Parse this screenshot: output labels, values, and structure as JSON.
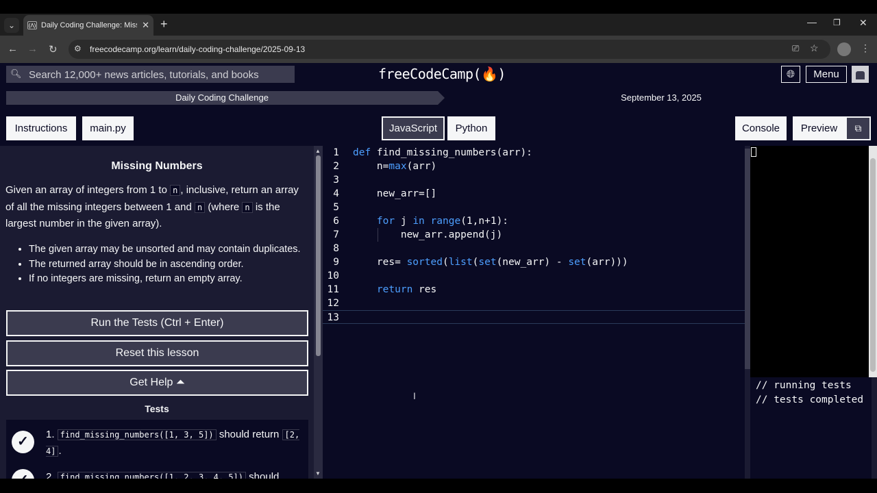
{
  "browser": {
    "tab_title": "Daily Coding Challenge: Missing Numbers",
    "tab_favicon": "fcc-icon",
    "url": "freecodecamp.org/learn/daily-coding-challenge/2025-09-13",
    "icons": [
      "tab-list-icon",
      "close-icon",
      "plus-icon",
      "minimize-icon",
      "restore-icon",
      "close-window-icon",
      "back-icon",
      "forward-icon",
      "reload-icon",
      "site-info-icon",
      "install-icon",
      "star-icon",
      "kebab-menu-icon"
    ]
  },
  "nav": {
    "search_placeholder": "Search 12,000+ news articles, tutorials, and books",
    "logo": "freeCodeCamp(🔥)",
    "menu_label": "Menu"
  },
  "breadcrumb": {
    "section": "Daily Coding Challenge",
    "date": "September 13, 2025"
  },
  "toolbar": {
    "instructions": "Instructions",
    "file": "main.py",
    "lang_js": "JavaScript",
    "lang_py": "Python",
    "selected_language": "JavaScript",
    "console": "Console",
    "preview": "Preview"
  },
  "challenge": {
    "title": "Missing Numbers",
    "desc_1": "Given an array of integers from 1 to ",
    "n": "n",
    "desc_2": ", inclusive, return an array of all the missing integers between 1 and ",
    "desc_3": " (where ",
    "desc_4": " is the largest number in the given array).",
    "rules": [
      "The given array may be unsorted and may contain duplicates.",
      "The returned array should be in ascending order.",
      "If no integers are missing, return an empty array."
    ]
  },
  "actions": {
    "run": "Run the Tests (Ctrl + Enter)",
    "reset": "Reset this lesson",
    "help": "Get Help ⏶"
  },
  "tests": {
    "heading": "Tests",
    "items": [
      {
        "num": "1.",
        "code": "find_missing_numbers([1, 3, 5])",
        "text": " should return ",
        "result": "[2, 4]",
        "end": ".",
        "passed": true
      },
      {
        "num": "2.",
        "code": "find_missing_numbers([1, 2, 3, 4, 5])",
        "text": " should",
        "passed": true
      }
    ]
  },
  "editor": {
    "lines": [
      {
        "n": "1",
        "tokens": [
          [
            "kw",
            "def"
          ],
          [
            "",
            " find_missing_numbers(arr):"
          ]
        ]
      },
      {
        "n": "2",
        "tokens": [
          [
            "",
            "    n="
          ],
          [
            "fn",
            "max"
          ],
          [
            "",
            "(arr)"
          ]
        ]
      },
      {
        "n": "3",
        "tokens": []
      },
      {
        "n": "4",
        "tokens": [
          [
            "",
            "    new_arr=[]"
          ]
        ]
      },
      {
        "n": "5",
        "tokens": []
      },
      {
        "n": "6",
        "tokens": [
          [
            "",
            "    "
          ],
          [
            "kw",
            "for"
          ],
          [
            "",
            " j "
          ],
          [
            "kw",
            "in"
          ],
          [
            "",
            " "
          ],
          [
            "fn",
            "range"
          ],
          [
            "",
            "(1,n+1):"
          ]
        ]
      },
      {
        "n": "7",
        "tokens": [
          [
            "",
            "        new_arr.append(j)"
          ]
        ]
      },
      {
        "n": "8",
        "tokens": []
      },
      {
        "n": "9",
        "tokens": [
          [
            "",
            "    res= "
          ],
          [
            "fn",
            "sorted"
          ],
          [
            "",
            "("
          ],
          [
            "fn",
            "list"
          ],
          [
            "",
            "("
          ],
          [
            "fn",
            "set"
          ],
          [
            "",
            "(new_arr) - "
          ],
          [
            "fn",
            "set"
          ],
          [
            "",
            "(arr)))"
          ]
        ]
      },
      {
        "n": "10",
        "tokens": []
      },
      {
        "n": "11",
        "tokens": [
          [
            "",
            "    "
          ],
          [
            "kw",
            "return"
          ],
          [
            "",
            " res"
          ]
        ]
      },
      {
        "n": "12",
        "tokens": []
      },
      {
        "n": "13",
        "tokens": []
      }
    ]
  },
  "console": {
    "lines": [
      "// running tests",
      "// tests completed"
    ]
  }
}
